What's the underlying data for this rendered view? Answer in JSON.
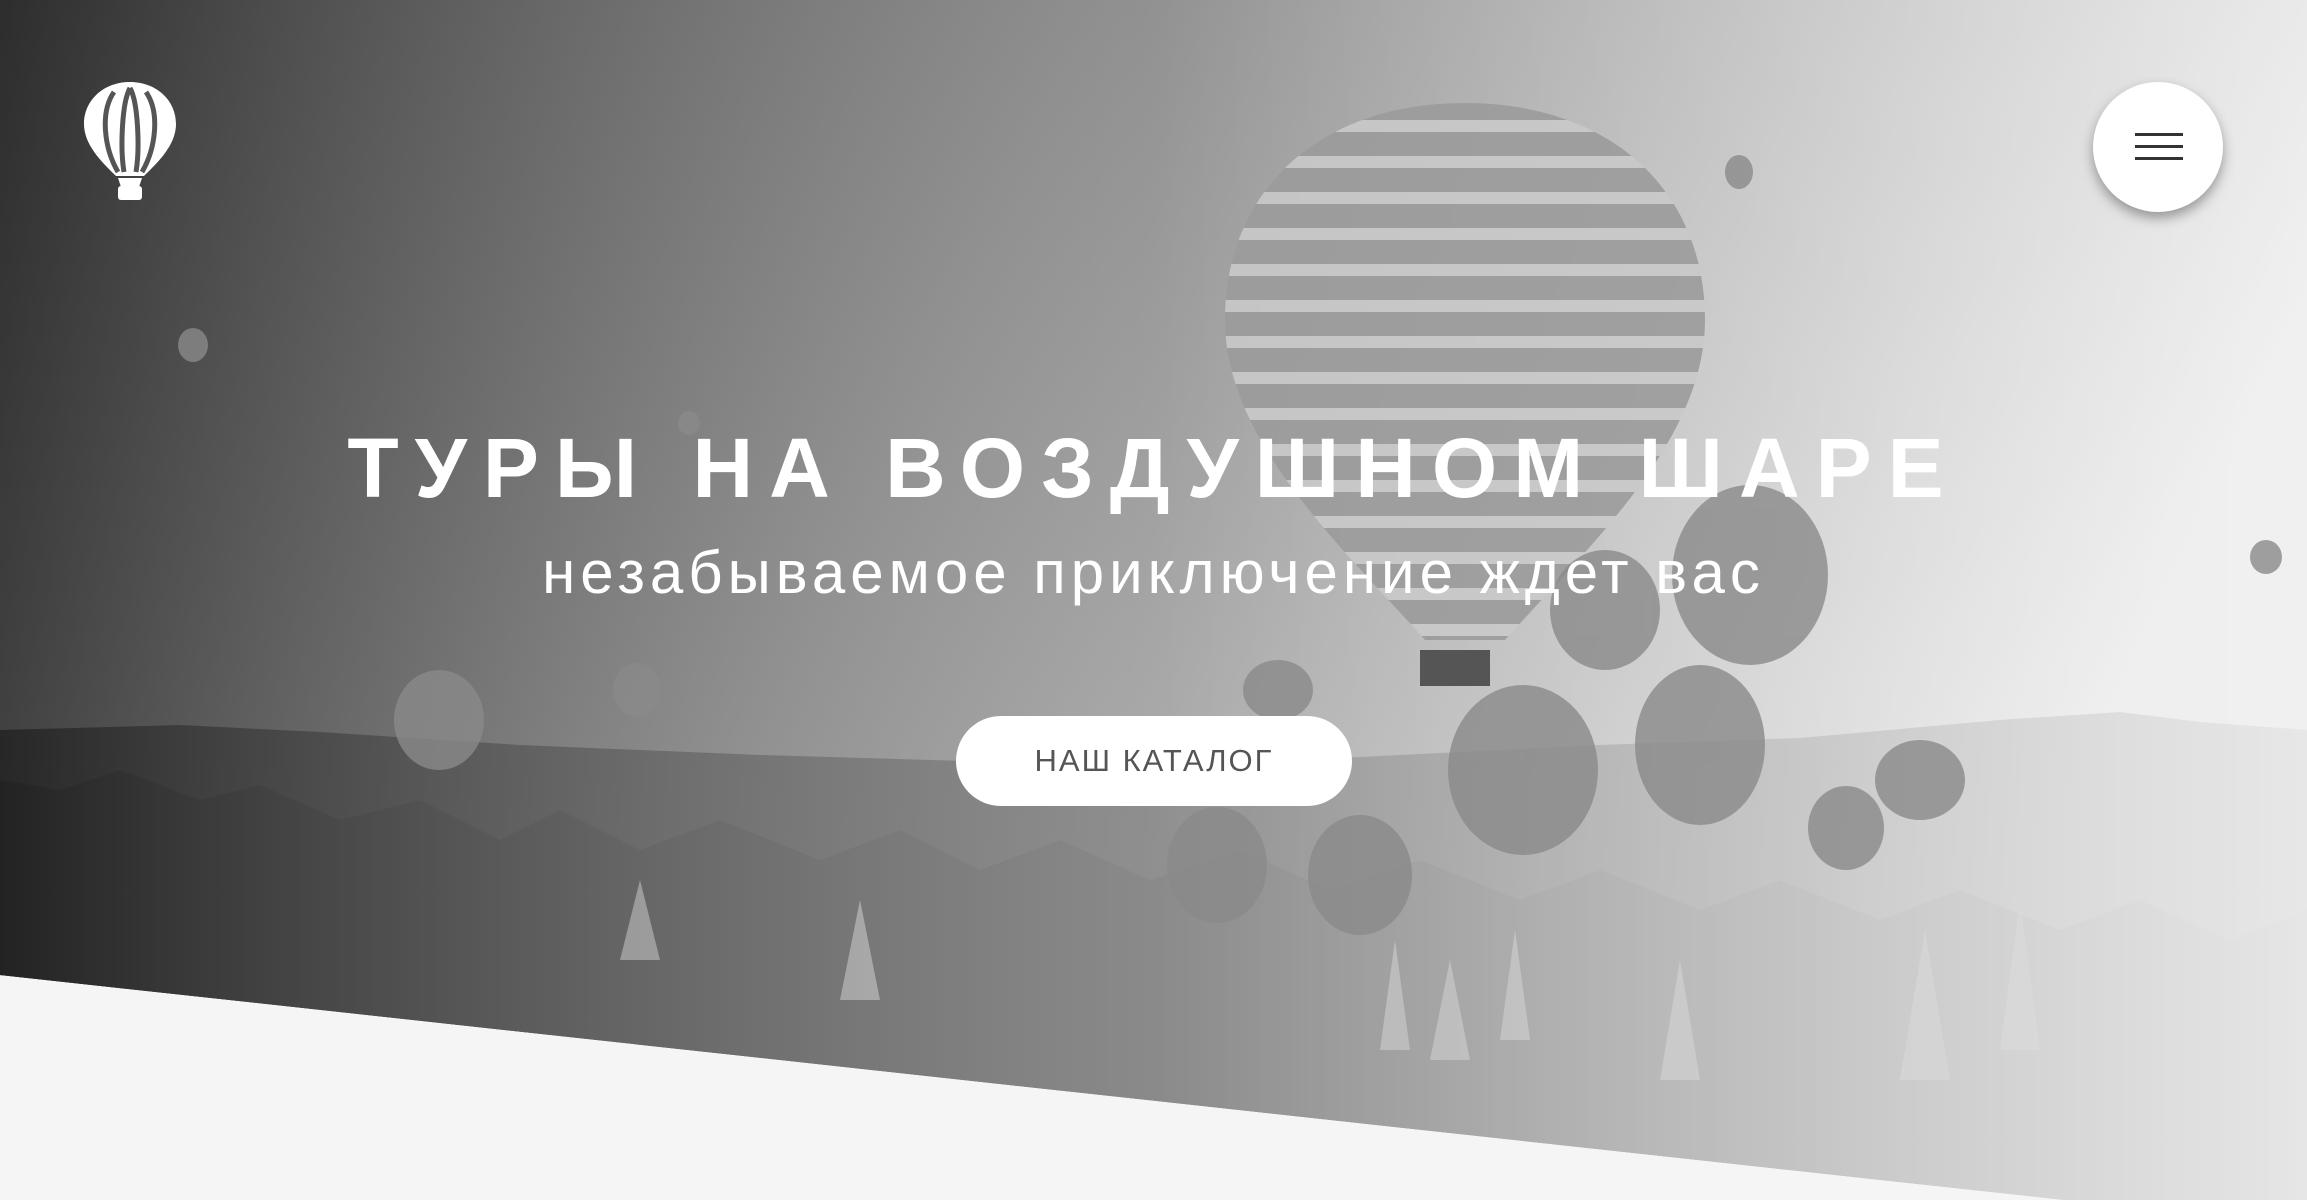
{
  "header": {
    "logo_icon": "hot-air-balloon-icon",
    "menu_icon": "hamburger-menu-icon"
  },
  "hero": {
    "title": "ТУРЫ НА ВОЗДУШНОМ ШАРЕ",
    "subtitle": "незабываемое приключение ждет вас",
    "cta_label": "НАШ КАТАЛОГ"
  },
  "colors": {
    "text_light": "#ffffff",
    "button_bg": "#ffffff",
    "button_text": "#555555",
    "page_bg": "#f5f5f5",
    "hero_dark": "#3a3a3a",
    "hero_light": "#e6e6e6"
  }
}
